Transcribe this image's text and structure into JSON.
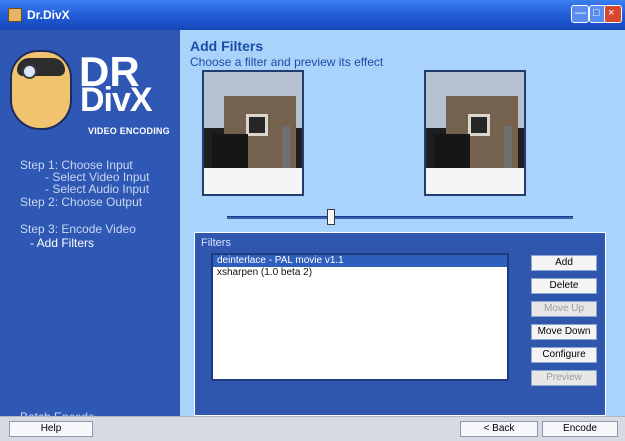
{
  "window": {
    "title": "Dr.DivX"
  },
  "brand": {
    "line1": "DR",
    "line2": "DivX",
    "tagline": "VIDEO ENCODING"
  },
  "sidebar": {
    "steps": [
      {
        "label": "Step 1: Choose Input"
      },
      {
        "label": "- Select Video Input"
      },
      {
        "label": "- Select Audio Input"
      },
      {
        "label": "Step 2: Choose Output"
      },
      {
        "label": "Step 3: Encode Video"
      },
      {
        "label": "- Add Filters"
      }
    ],
    "batch_label": "Batch Encode"
  },
  "page": {
    "title": "Add Filters",
    "subtitle": "Choose a filter and preview its effect"
  },
  "filters": {
    "label": "Filters",
    "items": [
      {
        "label": "deinterlace - PAL movie v1.1",
        "selected": true
      },
      {
        "label": "xsharpen (1.0 beta 2)",
        "selected": false
      }
    ],
    "buttons": {
      "add": "Add",
      "delete": "Delete",
      "move_up": "Move Up",
      "move_down": "Move Down",
      "configure": "Configure",
      "extra": "Preview"
    }
  },
  "footer": {
    "help": "Help",
    "back": "< Back",
    "encode": "Encode"
  },
  "colors": {
    "sidebar": "#2f57b4",
    "main": "#a9d3fb",
    "accent": "#1b4ca7"
  }
}
